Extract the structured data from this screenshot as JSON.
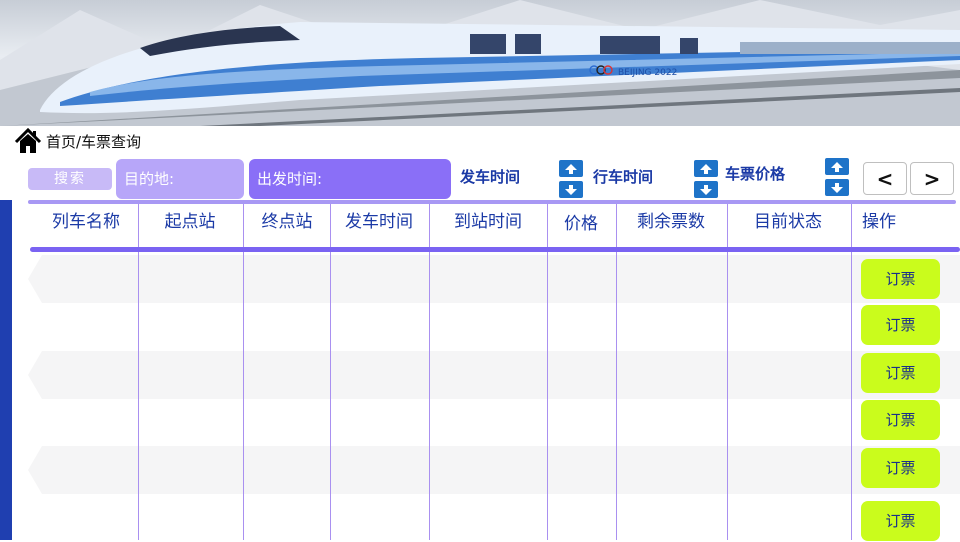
{
  "breadcrumb": {
    "text": "首页/车票查询"
  },
  "toolbar": {
    "search_label": "搜索",
    "destination_label": "目的地:",
    "departure_time_label": "出发时间:",
    "sort_departure_label": "发车时间",
    "sort_duration_label": "行车时间",
    "sort_price_label": "车票价格",
    "prev_page": "<",
    "next_page": ">"
  },
  "banner": {
    "train_livery": "BEIJING 2022"
  },
  "table": {
    "columns": [
      "列车名称",
      "起点站",
      "终点站",
      "发车时间",
      "到站时间",
      "价格",
      "剩余票数",
      "目前状态",
      "操作"
    ],
    "rows": [
      {
        "action": "订票"
      },
      {
        "action": "订票"
      },
      {
        "action": "订票"
      },
      {
        "action": "订票"
      },
      {
        "action": "订票"
      },
      {
        "action": "订票"
      }
    ]
  },
  "colors": {
    "accent_purple": "#7a63f2",
    "light_purple": "#b7a6f9",
    "header_text": "#1b3aa6",
    "book_button": "#cafc1c",
    "sort_arrow": "#1e73c8"
  },
  "icons": [
    "home-icon",
    "arrow-up-icon",
    "arrow-down-icon",
    "chevron-left-icon",
    "chevron-right-icon"
  ]
}
